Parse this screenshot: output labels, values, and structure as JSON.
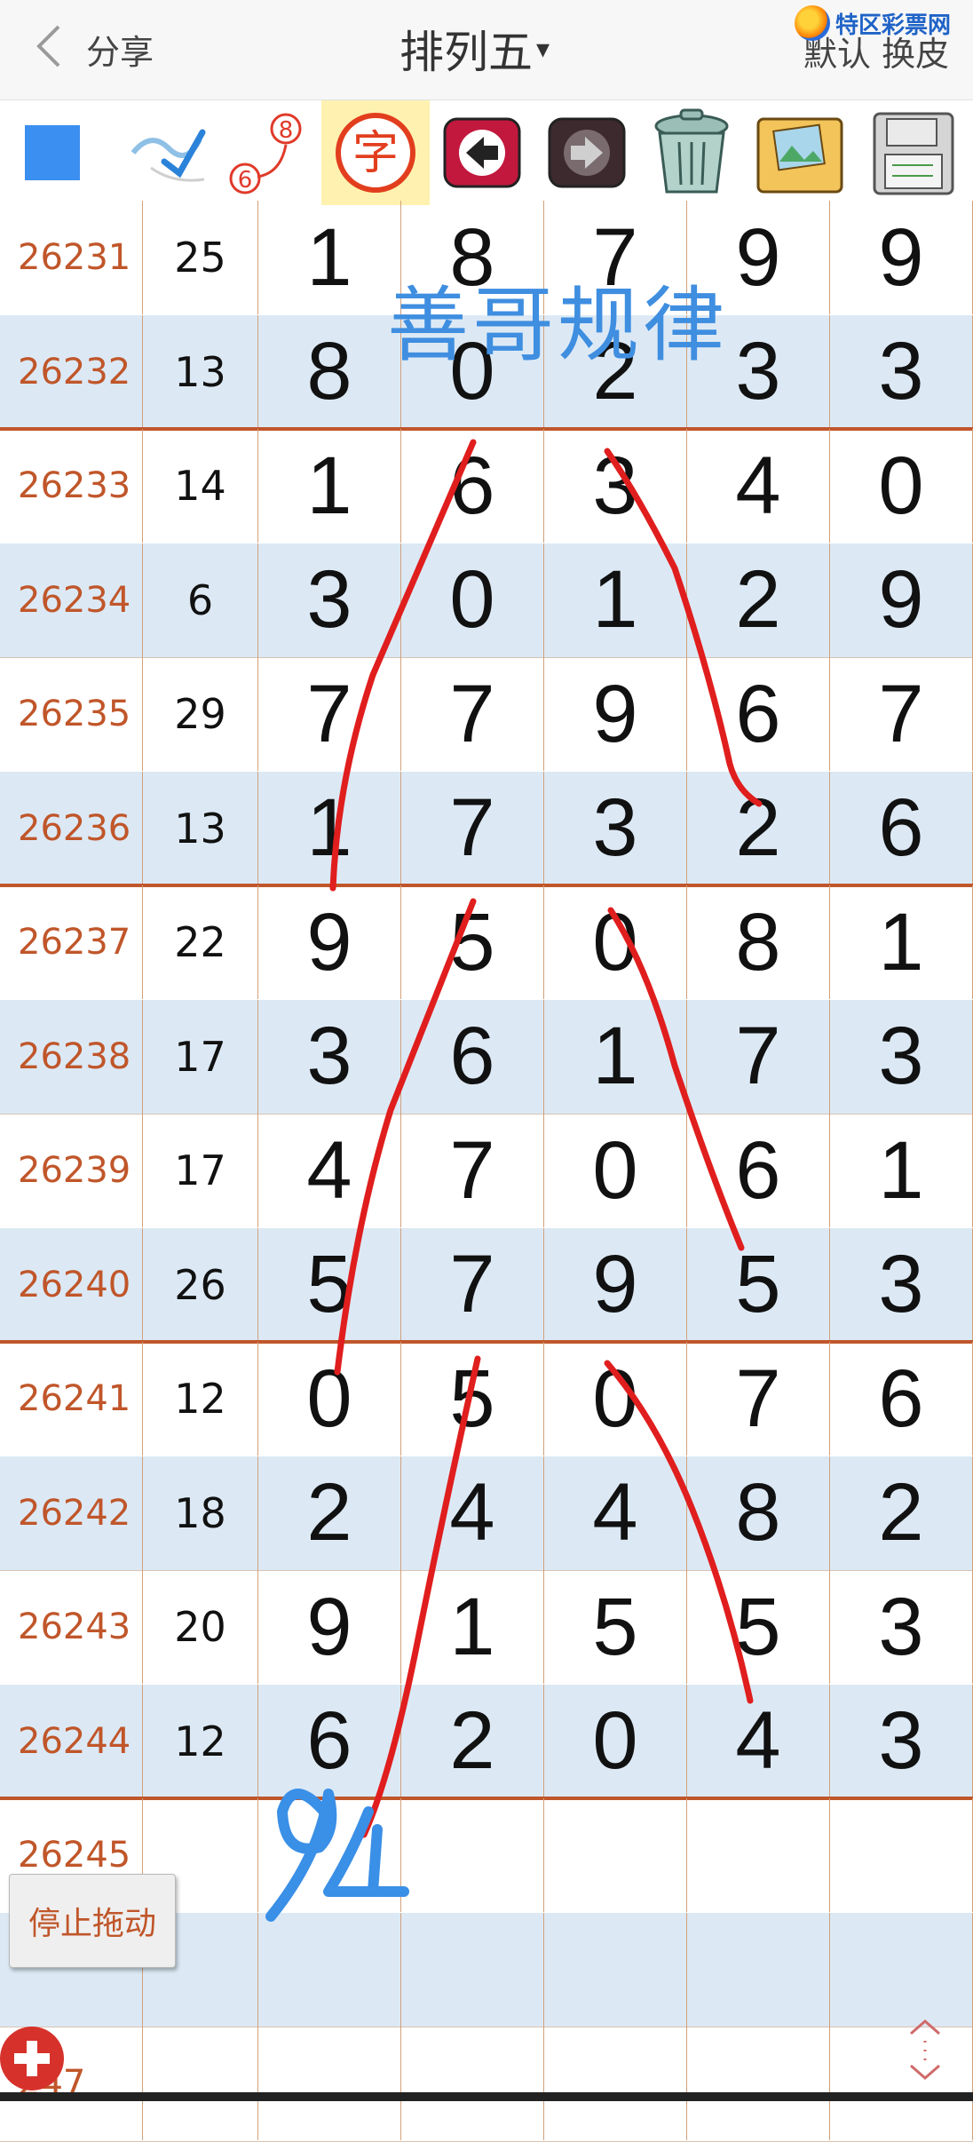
{
  "header": {
    "back_label": "分享",
    "title": "排列五",
    "title_arrow": "▾",
    "right_label": "默认 换皮",
    "logo_text": "特区彩票网"
  },
  "toolbar": {
    "tools": [
      "color-square",
      "pen",
      "number-path",
      "text-tool",
      "undo",
      "redo",
      "trash",
      "image",
      "save"
    ],
    "badge_top": "8",
    "badge_bottom": "6",
    "text_tool_label": "字"
  },
  "table": {
    "rows": [
      {
        "issue": "26231",
        "sum": "25",
        "d": [
          "1",
          "8",
          "7",
          "9",
          "9"
        ]
      },
      {
        "issue": "26232",
        "sum": "13",
        "d": [
          "8",
          "0",
          "2",
          "3",
          "3"
        ]
      },
      {
        "issue": "26233",
        "sum": "14",
        "d": [
          "1",
          "6",
          "3",
          "4",
          "0"
        ]
      },
      {
        "issue": "26234",
        "sum": "6",
        "d": [
          "3",
          "0",
          "1",
          "2",
          "9"
        ]
      },
      {
        "issue": "26235",
        "sum": "29",
        "d": [
          "7",
          "7",
          "9",
          "6",
          "7"
        ]
      },
      {
        "issue": "26236",
        "sum": "13",
        "d": [
          "1",
          "7",
          "3",
          "2",
          "6"
        ]
      },
      {
        "issue": "26237",
        "sum": "22",
        "d": [
          "9",
          "5",
          "0",
          "8",
          "1"
        ]
      },
      {
        "issue": "26238",
        "sum": "17",
        "d": [
          "3",
          "6",
          "1",
          "7",
          "3"
        ]
      },
      {
        "issue": "26239",
        "sum": "17",
        "d": [
          "4",
          "7",
          "0",
          "6",
          "1"
        ]
      },
      {
        "issue": "26240",
        "sum": "26",
        "d": [
          "5",
          "7",
          "9",
          "5",
          "3"
        ]
      },
      {
        "issue": "26241",
        "sum": "12",
        "d": [
          "0",
          "5",
          "0",
          "7",
          "6"
        ]
      },
      {
        "issue": "26242",
        "sum": "18",
        "d": [
          "2",
          "4",
          "4",
          "8",
          "2"
        ]
      },
      {
        "issue": "26243",
        "sum": "20",
        "d": [
          "9",
          "1",
          "5",
          "5",
          "3"
        ]
      },
      {
        "issue": "26244",
        "sum": "12",
        "d": [
          "6",
          "2",
          "0",
          "4",
          "3"
        ]
      },
      {
        "issue": "26245",
        "sum": "",
        "d": [
          "",
          "",
          "",
          "",
          ""
        ]
      },
      {
        "issue": "",
        "sum": "",
        "d": [
          "",
          "",
          "",
          "",
          ""
        ]
      },
      {
        "issue": "247",
        "sum": "",
        "d": [
          "",
          "",
          "",
          "",
          ""
        ]
      }
    ]
  },
  "annotations": {
    "watermark": "善哥规律",
    "handwritten": "94"
  },
  "buttons": {
    "stop_drag": "停止拖动"
  },
  "colors": {
    "issue_text": "#c0562a",
    "alt_row": "#dce9f5",
    "draw_red": "#e01e1e",
    "draw_blue": "#3a8fe6"
  }
}
